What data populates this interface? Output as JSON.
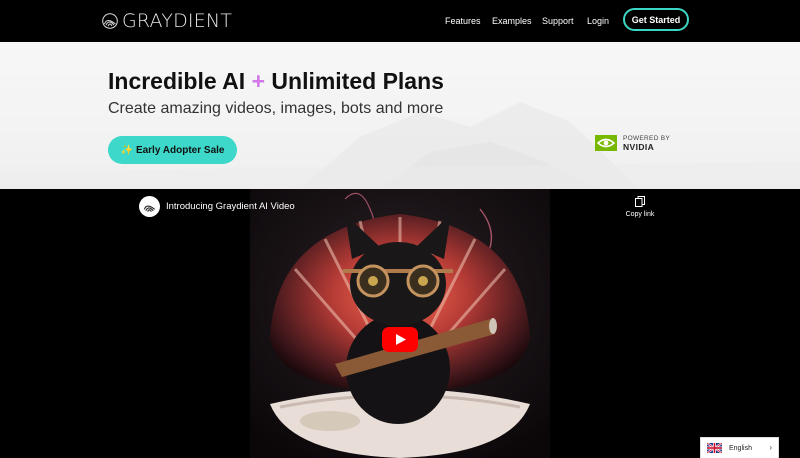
{
  "nav": {
    "brand": "GRAYDIENT",
    "links": [
      "Features",
      "Examples",
      "Support",
      "Login"
    ],
    "cta": "Get Started"
  },
  "hero": {
    "title_part1": "Incredible AI",
    "title_plus": "+",
    "title_part2": "Unlimited Plans",
    "subtitle": "Create amazing videos, images, bots and more",
    "sale_button": "Early Adopter Sale",
    "powered_by": "POWERED BY",
    "nvidia": "NVIDIA"
  },
  "video": {
    "title": "Introducing Graydient AI Video",
    "copy_label": "Copy link"
  },
  "language": {
    "current": "English"
  },
  "colors": {
    "accent": "#3dd8c9",
    "plus": "#d277e6",
    "nvidia_green": "#76b900",
    "youtube_red": "#ff0000"
  }
}
